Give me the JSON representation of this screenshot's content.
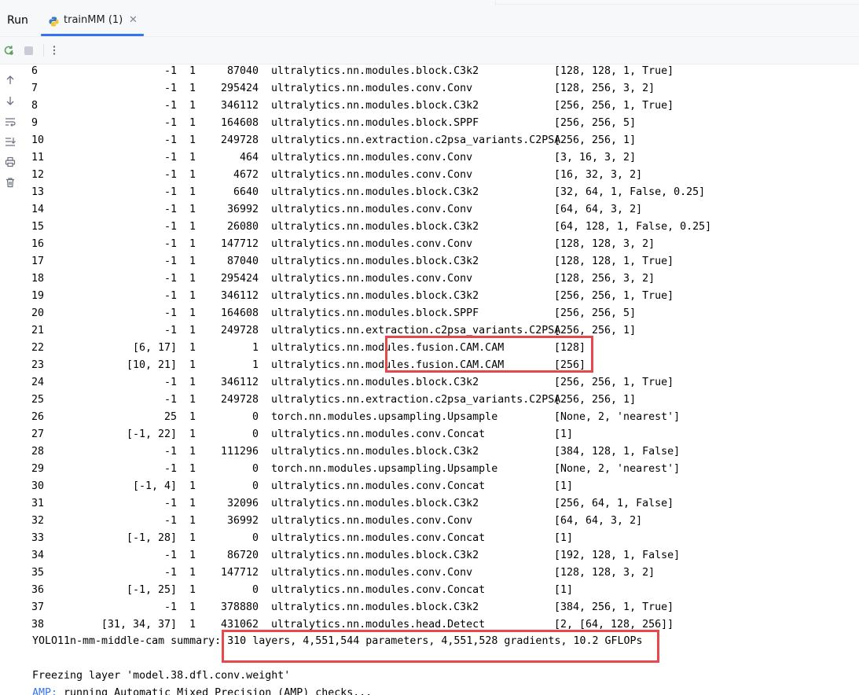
{
  "tool_window": {
    "title": "Run",
    "tab": {
      "label": "trainMM (1)",
      "icon": "python-icon",
      "close_icon": "close-icon"
    }
  },
  "toolbar": {
    "buttons": [
      {
        "name": "rerun-button",
        "icon": "rerun-icon"
      },
      {
        "name": "stop-button",
        "icon": "stop-icon"
      },
      {
        "name": "more-options-button",
        "icon": "vertical-ellipsis-icon"
      }
    ]
  },
  "gutter": {
    "buttons": [
      {
        "name": "scroll-up-button",
        "icon": "arrow-up-icon"
      },
      {
        "name": "scroll-down-button",
        "icon": "arrow-down-icon"
      },
      {
        "name": "soft-wrap-button",
        "icon": "soft-wrap-icon"
      },
      {
        "name": "scroll-to-end-button",
        "icon": "scroll-to-end-icon"
      },
      {
        "name": "print-button",
        "icon": "print-icon"
      },
      {
        "name": "clear-all-button",
        "icon": "trash-icon"
      }
    ]
  },
  "console": {
    "layers": [
      {
        "idx": "6",
        "from": "-1",
        "n": "1",
        "params": "87040",
        "module": "ultralytics.nn.modules.block.C3k2",
        "args": "[128, 128, 1, True]"
      },
      {
        "idx": "7",
        "from": "-1",
        "n": "1",
        "params": "295424",
        "module": "ultralytics.nn.modules.conv.Conv",
        "args": "[128, 256, 3, 2]"
      },
      {
        "idx": "8",
        "from": "-1",
        "n": "1",
        "params": "346112",
        "module": "ultralytics.nn.modules.block.C3k2",
        "args": "[256, 256, 1, True]"
      },
      {
        "idx": "9",
        "from": "-1",
        "n": "1",
        "params": "164608",
        "module": "ultralytics.nn.modules.block.SPPF",
        "args": "[256, 256, 5]"
      },
      {
        "idx": "10",
        "from": "-1",
        "n": "1",
        "params": "249728",
        "module": "ultralytics.nn.extraction.c2psa_variants.C2PSA",
        "args": "[256, 256, 1]"
      },
      {
        "idx": "11",
        "from": "-1",
        "n": "1",
        "params": "464",
        "module": "ultralytics.nn.modules.conv.Conv",
        "args": "[3, 16, 3, 2]"
      },
      {
        "idx": "12",
        "from": "-1",
        "n": "1",
        "params": "4672",
        "module": "ultralytics.nn.modules.conv.Conv",
        "args": "[16, 32, 3, 2]"
      },
      {
        "idx": "13",
        "from": "-1",
        "n": "1",
        "params": "6640",
        "module": "ultralytics.nn.modules.block.C3k2",
        "args": "[32, 64, 1, False, 0.25]"
      },
      {
        "idx": "14",
        "from": "-1",
        "n": "1",
        "params": "36992",
        "module": "ultralytics.nn.modules.conv.Conv",
        "args": "[64, 64, 3, 2]"
      },
      {
        "idx": "15",
        "from": "-1",
        "n": "1",
        "params": "26080",
        "module": "ultralytics.nn.modules.block.C3k2",
        "args": "[64, 128, 1, False, 0.25]"
      },
      {
        "idx": "16",
        "from": "-1",
        "n": "1",
        "params": "147712",
        "module": "ultralytics.nn.modules.conv.Conv",
        "args": "[128, 128, 3, 2]"
      },
      {
        "idx": "17",
        "from": "-1",
        "n": "1",
        "params": "87040",
        "module": "ultralytics.nn.modules.block.C3k2",
        "args": "[128, 128, 1, True]"
      },
      {
        "idx": "18",
        "from": "-1",
        "n": "1",
        "params": "295424",
        "module": "ultralytics.nn.modules.conv.Conv",
        "args": "[128, 256, 3, 2]"
      },
      {
        "idx": "19",
        "from": "-1",
        "n": "1",
        "params": "346112",
        "module": "ultralytics.nn.modules.block.C3k2",
        "args": "[256, 256, 1, True]"
      },
      {
        "idx": "20",
        "from": "-1",
        "n": "1",
        "params": "164608",
        "module": "ultralytics.nn.modules.block.SPPF",
        "args": "[256, 256, 5]"
      },
      {
        "idx": "21",
        "from": "-1",
        "n": "1",
        "params": "249728",
        "module": "ultralytics.nn.extraction.c2psa_variants.C2PSA",
        "args": "[256, 256, 1]"
      },
      {
        "idx": "22",
        "from": "[6, 17]",
        "n": "1",
        "params": "1",
        "module": "ultralytics.nn.modules.fusion.CAM.CAM",
        "args": "[128]"
      },
      {
        "idx": "23",
        "from": "[10, 21]",
        "n": "1",
        "params": "1",
        "module": "ultralytics.nn.modules.fusion.CAM.CAM",
        "args": "[256]"
      },
      {
        "idx": "24",
        "from": "-1",
        "n": "1",
        "params": "346112",
        "module": "ultralytics.nn.modules.block.C3k2",
        "args": "[256, 256, 1, True]"
      },
      {
        "idx": "25",
        "from": "-1",
        "n": "1",
        "params": "249728",
        "module": "ultralytics.nn.extraction.c2psa_variants.C2PSA",
        "args": "[256, 256, 1]"
      },
      {
        "idx": "26",
        "from": "25",
        "n": "1",
        "params": "0",
        "module": "torch.nn.modules.upsampling.Upsample",
        "args": "[None, 2, 'nearest']"
      },
      {
        "idx": "27",
        "from": "[-1, 22]",
        "n": "1",
        "params": "0",
        "module": "ultralytics.nn.modules.conv.Concat",
        "args": "[1]"
      },
      {
        "idx": "28",
        "from": "-1",
        "n": "1",
        "params": "111296",
        "module": "ultralytics.nn.modules.block.C3k2",
        "args": "[384, 128, 1, False]"
      },
      {
        "idx": "29",
        "from": "-1",
        "n": "1",
        "params": "0",
        "module": "torch.nn.modules.upsampling.Upsample",
        "args": "[None, 2, 'nearest']"
      },
      {
        "idx": "30",
        "from": "[-1, 4]",
        "n": "1",
        "params": "0",
        "module": "ultralytics.nn.modules.conv.Concat",
        "args": "[1]"
      },
      {
        "idx": "31",
        "from": "-1",
        "n": "1",
        "params": "32096",
        "module": "ultralytics.nn.modules.block.C3k2",
        "args": "[256, 64, 1, False]"
      },
      {
        "idx": "32",
        "from": "-1",
        "n": "1",
        "params": "36992",
        "module": "ultralytics.nn.modules.conv.Conv",
        "args": "[64, 64, 3, 2]"
      },
      {
        "idx": "33",
        "from": "[-1, 28]",
        "n": "1",
        "params": "0",
        "module": "ultralytics.nn.modules.conv.Concat",
        "args": "[1]"
      },
      {
        "idx": "34",
        "from": "-1",
        "n": "1",
        "params": "86720",
        "module": "ultralytics.nn.modules.block.C3k2",
        "args": "[192, 128, 1, False]"
      },
      {
        "idx": "35",
        "from": "-1",
        "n": "1",
        "params": "147712",
        "module": "ultralytics.nn.modules.conv.Conv",
        "args": "[128, 128, 3, 2]"
      },
      {
        "idx": "36",
        "from": "[-1, 25]",
        "n": "1",
        "params": "0",
        "module": "ultralytics.nn.modules.conv.Concat",
        "args": "[1]"
      },
      {
        "idx": "37",
        "from": "-1",
        "n": "1",
        "params": "378880",
        "module": "ultralytics.nn.modules.block.C3k2",
        "args": "[384, 256, 1, True]"
      },
      {
        "idx": "38",
        "from": "[31, 34, 37]",
        "n": "1",
        "params": "431062",
        "module": "ultralytics.nn.modules.head.Detect",
        "args": "[2, [64, 128, 256]]"
      }
    ],
    "summary_prefix": "YOLO11n-mm-middle-cam summary: ",
    "summary_stats": "310 layers, 4,551,544 parameters, 4,551,528 gradients, 10.2 GFLOPs",
    "freezing_line": "Freezing layer 'model.38.dfl.conv.weight'",
    "amp_tag": "AMP:",
    "amp_text": " running Automatic Mixed Precision (AMP) checks..."
  },
  "colors": {
    "highlight_box": "#e8474b",
    "accent": "#3574f0"
  }
}
